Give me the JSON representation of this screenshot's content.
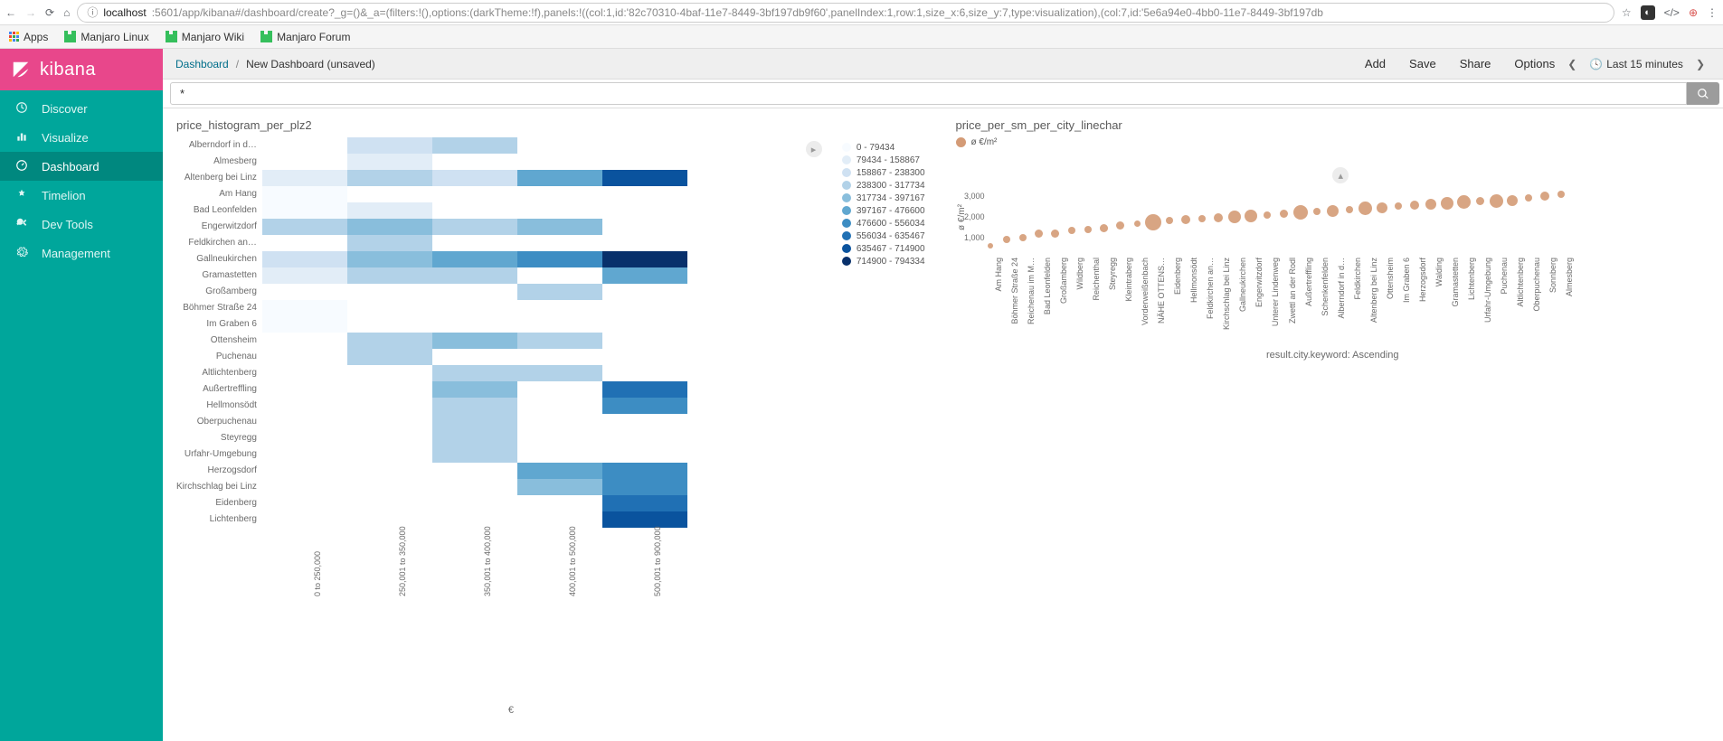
{
  "browser": {
    "url_host": "localhost",
    "url_path": ":5601/app/kibana#/dashboard/create?_g=()&_a=(filters:!(),options:(darkTheme:!f),panels:!((col:1,id:'82c70310-4baf-11e7-8449-3bf197db9f60',panelIndex:1,row:1,size_x:6,size_y:7,type:visualization),(col:7,id:'5e6a94e0-4bb0-11e7-8449-3bf197db",
    "bookmarks": [
      "Apps",
      "Manjaro Linux",
      "Manjaro Wiki",
      "Manjaro Forum"
    ]
  },
  "sidebar": {
    "brand": "kibana",
    "items": [
      {
        "icon": "discover",
        "label": "Discover"
      },
      {
        "icon": "visualize",
        "label": "Visualize"
      },
      {
        "icon": "dashboard",
        "label": "Dashboard"
      },
      {
        "icon": "timelion",
        "label": "Timelion"
      },
      {
        "icon": "devtools",
        "label": "Dev Tools"
      },
      {
        "icon": "management",
        "label": "Management"
      }
    ],
    "active_index": 2
  },
  "topbar": {
    "crumb_root": "Dashboard",
    "crumb_current": "New Dashboard (unsaved)",
    "actions": [
      "Add",
      "Save",
      "Share",
      "Options"
    ],
    "time_label": "Last 15 minutes"
  },
  "query": {
    "value": "*"
  },
  "panels": {
    "left": {
      "title": "price_histogram_per_plz2",
      "x_label": "€"
    },
    "right": {
      "title": "price_per_sm_per_city_linechar",
      "legend_label": "ø €/m²",
      "y_label": "ø €/m²",
      "x_label": "result.city.keyword: Ascending"
    }
  },
  "chart_data": [
    {
      "type": "heatmap",
      "title": "price_histogram_per_plz2",
      "x_categories": [
        "0 to 250,000",
        "250,001 to 350,000",
        "350,001 to 400,000",
        "400,001 to 500,000",
        "500,001 to 900,000"
      ],
      "y_categories": [
        "Alberndorf in d…",
        "Almesberg",
        "Altenberg bei Linz",
        "Am Hang",
        "Bad Leonfelden",
        "Engerwitzdorf",
        "Feldkirchen an…",
        "Gallneukirchen",
        "Gramastetten",
        "Großamberg",
        "Böhmer Straße 24",
        "Im Graben 6",
        "Ottensheim",
        "Puchenau",
        "Altlichtenberg",
        "Außertreffling",
        "Hellmonsödt",
        "Oberpuchenau",
        "Steyregg",
        "Urfahr-Umgebung",
        "Herzogsdorf",
        "Kirchschlag bei Linz",
        "Eidenberg",
        "Lichtenberg"
      ],
      "legend_bins": [
        "0 - 79434",
        "79434 - 158867",
        "158867 - 238300",
        "238300 - 317734",
        "317734 - 397167",
        "397167 - 476600",
        "476600 - 556034",
        "556034 - 635467",
        "635467 - 714900",
        "714900 - 794334"
      ],
      "legend_colors": [
        "#f7fbff",
        "#e2edf7",
        "#cfe1f2",
        "#b2d2e8",
        "#89bedc",
        "#60a7d0",
        "#3d8dc3",
        "#2070b4",
        "#0a539e",
        "#08306b"
      ],
      "matrix": [
        [
          null,
          2,
          3,
          null,
          null
        ],
        [
          null,
          1,
          null,
          null,
          null
        ],
        [
          1,
          3,
          2,
          5,
          8
        ],
        [
          0,
          null,
          null,
          null,
          null
        ],
        [
          0,
          1,
          null,
          null,
          null
        ],
        [
          3,
          4,
          3,
          4,
          null
        ],
        [
          null,
          3,
          null,
          null,
          null
        ],
        [
          2,
          4,
          5,
          6,
          9
        ],
        [
          1,
          3,
          3,
          null,
          5
        ],
        [
          null,
          null,
          null,
          3,
          null
        ],
        [
          0,
          null,
          null,
          null,
          null
        ],
        [
          0,
          null,
          null,
          null,
          null
        ],
        [
          null,
          3,
          4,
          3,
          null
        ],
        [
          null,
          3,
          null,
          null,
          null
        ],
        [
          null,
          null,
          3,
          3,
          null
        ],
        [
          null,
          null,
          4,
          null,
          7
        ],
        [
          null,
          null,
          3,
          null,
          6
        ],
        [
          null,
          null,
          3,
          null,
          null
        ],
        [
          null,
          null,
          3,
          null,
          null
        ],
        [
          null,
          null,
          3,
          null,
          null
        ],
        [
          null,
          null,
          null,
          5,
          6
        ],
        [
          null,
          null,
          null,
          4,
          6
        ],
        [
          null,
          null,
          null,
          null,
          7
        ],
        [
          null,
          null,
          null,
          null,
          8
        ]
      ]
    },
    {
      "type": "scatter",
      "title": "price_per_sm_per_city_linechar",
      "y_ticks": [
        1000,
        2000,
        3000
      ],
      "ylim": [
        0,
        3500
      ],
      "series": [
        {
          "name": "ø €/m²",
          "color": "#d49b76",
          "points": [
            {
              "city": "Am Hang",
              "value": 400,
              "size": 6
            },
            {
              "city": "Böhmer Straße 24",
              "value": 700,
              "size": 8
            },
            {
              "city": "Reichenau im M…",
              "value": 800,
              "size": 8
            },
            {
              "city": "Bad Leonfelden",
              "value": 1000,
              "size": 9
            },
            {
              "city": "Großamberg",
              "value": 1000,
              "size": 9
            },
            {
              "city": "Wildberg",
              "value": 1150,
              "size": 8
            },
            {
              "city": "Reichenthal",
              "value": 1200,
              "size": 8
            },
            {
              "city": "Steyregg",
              "value": 1250,
              "size": 9
            },
            {
              "city": "Kleintraberg",
              "value": 1400,
              "size": 9
            },
            {
              "city": "Vorderweißenbach",
              "value": 1480,
              "size": 7
            },
            {
              "city": "NÄHE OTTENS…",
              "value": 1550,
              "size": 18
            },
            {
              "city": "Eidenberg",
              "value": 1600,
              "size": 8
            },
            {
              "city": "Hellmonsödt",
              "value": 1650,
              "size": 10
            },
            {
              "city": "Feldkirchen an…",
              "value": 1700,
              "size": 8
            },
            {
              "city": "Kirchschlag bei Linz",
              "value": 1750,
              "size": 10
            },
            {
              "city": "Gallneukirchen",
              "value": 1800,
              "size": 14
            },
            {
              "city": "Engerwitzdorf",
              "value": 1850,
              "size": 14
            },
            {
              "city": "Unterer Lindenweg",
              "value": 1900,
              "size": 8
            },
            {
              "city": "Zwettl an der Rodl",
              "value": 1930,
              "size": 9
            },
            {
              "city": "Außertreffling",
              "value": 2000,
              "size": 16
            },
            {
              "city": "Schenkenfelden",
              "value": 2050,
              "size": 8
            },
            {
              "city": "Alberndorf in d…",
              "value": 2100,
              "size": 13
            },
            {
              "city": "Feldkirchen",
              "value": 2150,
              "size": 8
            },
            {
              "city": "Altenberg bei Linz",
              "value": 2200,
              "size": 15
            },
            {
              "city": "Ottensheim",
              "value": 2250,
              "size": 12
            },
            {
              "city": "Im Graben 6",
              "value": 2300,
              "size": 8
            },
            {
              "city": "Herzogsdorf",
              "value": 2350,
              "size": 10
            },
            {
              "city": "Walding",
              "value": 2400,
              "size": 12
            },
            {
              "city": "Gramastetten",
              "value": 2450,
              "size": 14
            },
            {
              "city": "Lichtenberg",
              "value": 2500,
              "size": 15
            },
            {
              "city": "Urfahr-Umgebung",
              "value": 2550,
              "size": 9
            },
            {
              "city": "Puchenau",
              "value": 2550,
              "size": 15
            },
            {
              "city": "Altlichtenberg",
              "value": 2600,
              "size": 12
            },
            {
              "city": "Oberpuchenau",
              "value": 2700,
              "size": 8
            },
            {
              "city": "Sonnberg",
              "value": 2800,
              "size": 10
            },
            {
              "city": "Almesberg",
              "value": 2900,
              "size": 8
            }
          ]
        }
      ]
    }
  ]
}
